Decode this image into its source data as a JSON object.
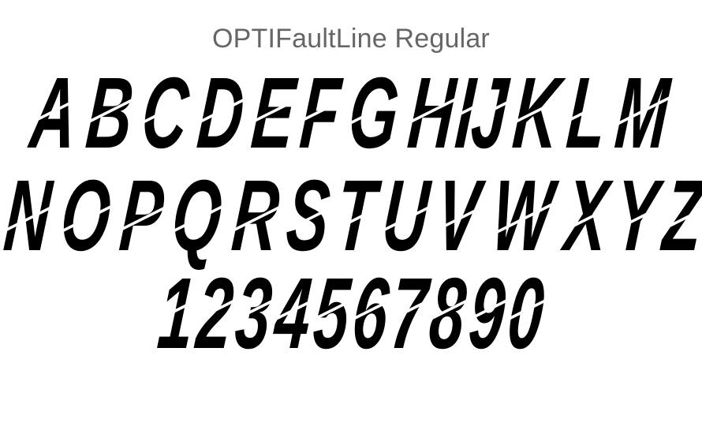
{
  "title": "OPTIFaultLine Regular",
  "rows": [
    [
      "A",
      "B",
      "C",
      "D",
      "E",
      "F",
      "G",
      "H",
      "I",
      "J",
      "K",
      "L",
      "M"
    ],
    [
      "N",
      "O",
      "P",
      "Q",
      "R",
      "S",
      "T",
      "U",
      "V",
      "W",
      "X",
      "Y",
      "Z"
    ],
    [
      "1",
      "2",
      "3",
      "4",
      "5",
      "6",
      "7",
      "8",
      "9",
      "0"
    ]
  ],
  "colors": {
    "title": "#666666",
    "glyph": "#000000",
    "background": "#ffffff"
  }
}
